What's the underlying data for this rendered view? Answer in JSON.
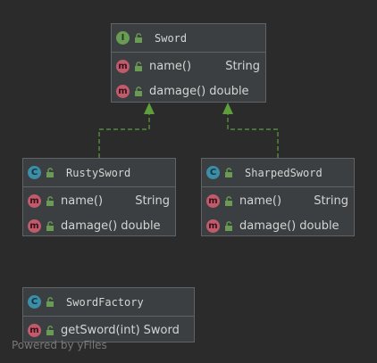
{
  "diagram": {
    "classes": [
      {
        "name": "Sword",
        "kind": "interface",
        "kind_letter": "I",
        "members": [
          {
            "name": "name()",
            "type": "String"
          },
          {
            "name": "damage()",
            "type": "double"
          }
        ]
      },
      {
        "name": "RustySword",
        "kind": "class",
        "kind_letter": "C",
        "members": [
          {
            "name": "name()",
            "type": "String"
          },
          {
            "name": "damage()",
            "type": "double"
          }
        ]
      },
      {
        "name": "SharpedSword",
        "kind": "class",
        "kind_letter": "C",
        "members": [
          {
            "name": "name()",
            "type": "String"
          },
          {
            "name": "damage()",
            "type": "double"
          }
        ]
      },
      {
        "name": "SwordFactory",
        "kind": "class",
        "kind_letter": "C",
        "members": [
          {
            "name": "getSword(int)",
            "type": "Sword"
          }
        ]
      }
    ],
    "method_letter": "m",
    "relations": [
      {
        "from": "RustySword",
        "to": "Sword",
        "type": "implements"
      },
      {
        "from": "SharpedSword",
        "to": "Sword",
        "type": "implements"
      }
    ],
    "watermark": "Powered by yFiles"
  },
  "colors": {
    "background": "#2b2b2b",
    "box": "#3c3f41",
    "border": "#5f6366",
    "interface_badge": "#6a9b54",
    "class_badge": "#3b8ea5",
    "method_badge": "#c05b6b",
    "lock": "#6a9b54",
    "implements_edge": "#5e9f3c"
  }
}
